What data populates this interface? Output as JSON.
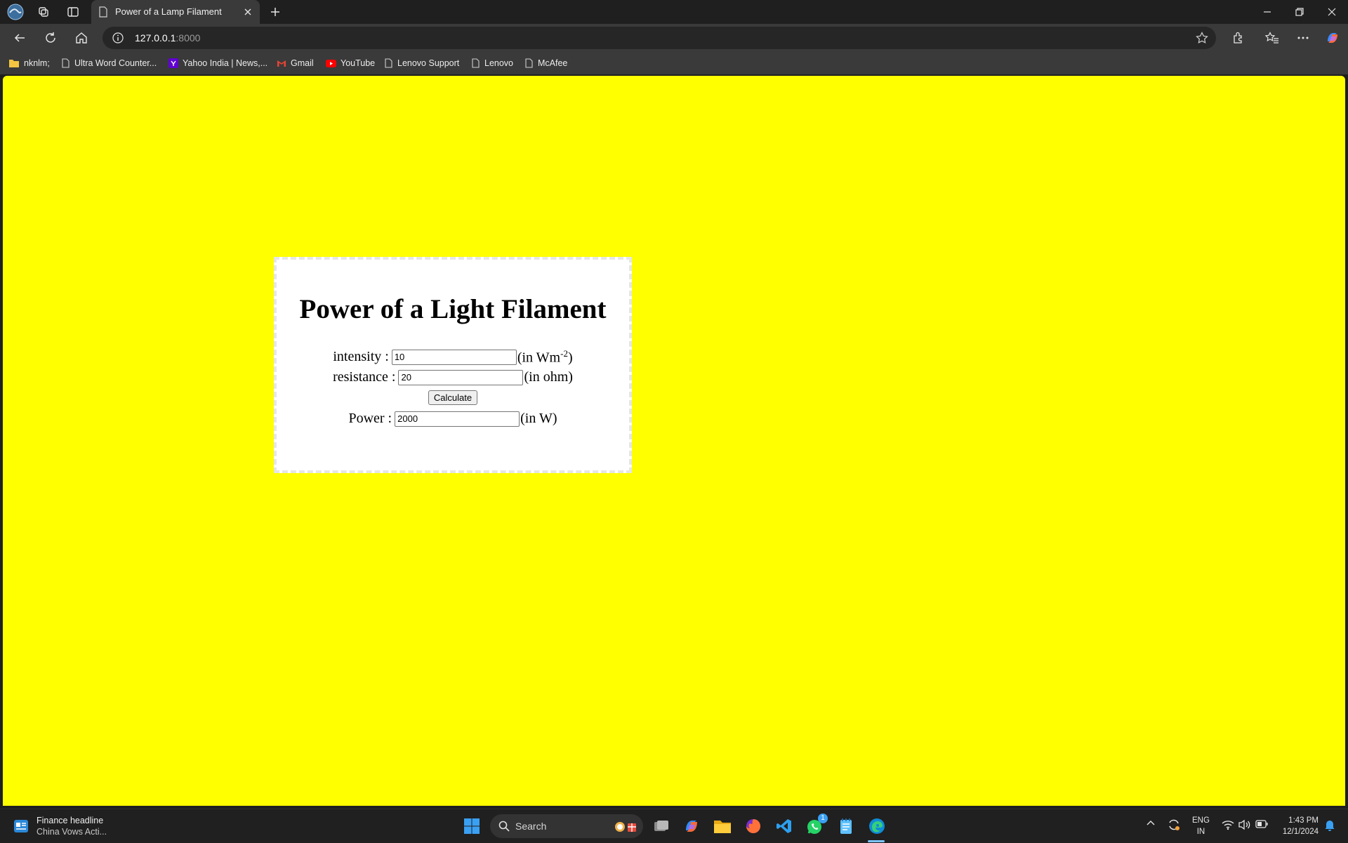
{
  "browser": {
    "tab_title": "Power of a Lamp Filament",
    "address": "127.0.0.1",
    "address_port": ":8000",
    "bookmarks": [
      {
        "label": "nknlm;",
        "icon": "folder-icon"
      },
      {
        "label": "Ultra Word Counter...",
        "icon": "page-icon"
      },
      {
        "label": "Yahoo India | News,...",
        "icon": "yahoo-icon"
      },
      {
        "label": "Gmail",
        "icon": "gmail-icon"
      },
      {
        "label": "YouTube",
        "icon": "youtube-icon"
      },
      {
        "label": "Lenovo Support",
        "icon": "page-icon"
      },
      {
        "label": "Lenovo",
        "icon": "page-icon"
      },
      {
        "label": "McAfee",
        "icon": "page-icon"
      }
    ]
  },
  "page": {
    "background": "#ffff00",
    "heading": "Power of a Light Filament",
    "intensity_label": "intensity :",
    "intensity_value": "10",
    "intensity_unit_prefix": "(in Wm",
    "intensity_unit_exp": "-2",
    "intensity_unit_suffix": ")",
    "resistance_label": "resistance :",
    "resistance_value": "20",
    "resistance_unit": "(in ohm)",
    "calculate_label": "Calculate",
    "power_label": "Power :",
    "power_value": "2000",
    "power_unit": "(in W)"
  },
  "taskbar": {
    "news_title": "Finance headline",
    "news_subtitle": "China Vows Acti...",
    "search_label": "Search",
    "whatsapp_badge": "1",
    "lang_top": "ENG",
    "lang_bottom": "IN",
    "time": "1:43 PM",
    "date": "12/1/2024"
  }
}
